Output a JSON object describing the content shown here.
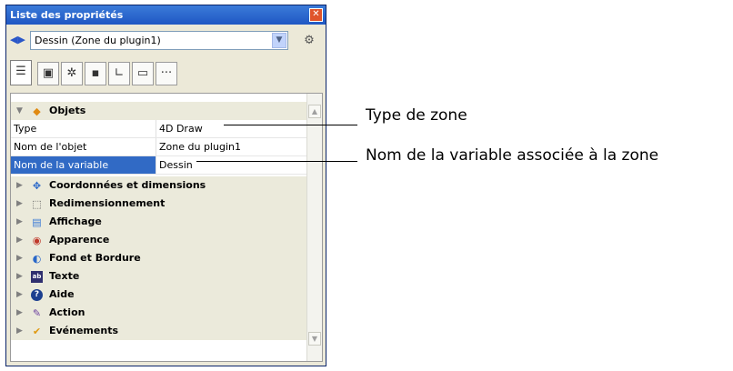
{
  "window": {
    "title": "Liste des propriétés"
  },
  "selector": {
    "value": "Dessin (Zone du plugin1)"
  },
  "tabs": [
    {
      "icon": "property-list-icon"
    },
    {
      "icon": "form-icon"
    },
    {
      "icon": "gear-icon"
    },
    {
      "icon": "objects-icon"
    },
    {
      "icon": "chart-icon"
    },
    {
      "icon": "monitor-icon"
    },
    {
      "icon": "more-icon"
    }
  ],
  "group_objets": {
    "label": "Objets",
    "rows": [
      {
        "key": "Type",
        "value": "4D Draw"
      },
      {
        "key": "Nom de l'objet",
        "value": "Zone du plugin1"
      },
      {
        "key": "Nom de la variable",
        "value": "Dessin"
      }
    ]
  },
  "categories": [
    {
      "label": "Coordonnées et dimensions",
      "icon": "coordinates-icon"
    },
    {
      "label": "Redimensionnement",
      "icon": "resize-icon"
    },
    {
      "label": "Affichage",
      "icon": "display-icon"
    },
    {
      "label": "Apparence",
      "icon": "appearance-icon"
    },
    {
      "label": "Fond et Bordure",
      "icon": "background-border-icon"
    },
    {
      "label": "Texte",
      "icon": "text-icon"
    },
    {
      "label": "Aide",
      "icon": "help-icon"
    },
    {
      "label": "Action",
      "icon": "action-icon"
    },
    {
      "label": "Evénements",
      "icon": "events-icon"
    }
  ],
  "callouts": {
    "type_label": "Type de zone",
    "variable_label": "Nom de la variable associée à la zone"
  }
}
